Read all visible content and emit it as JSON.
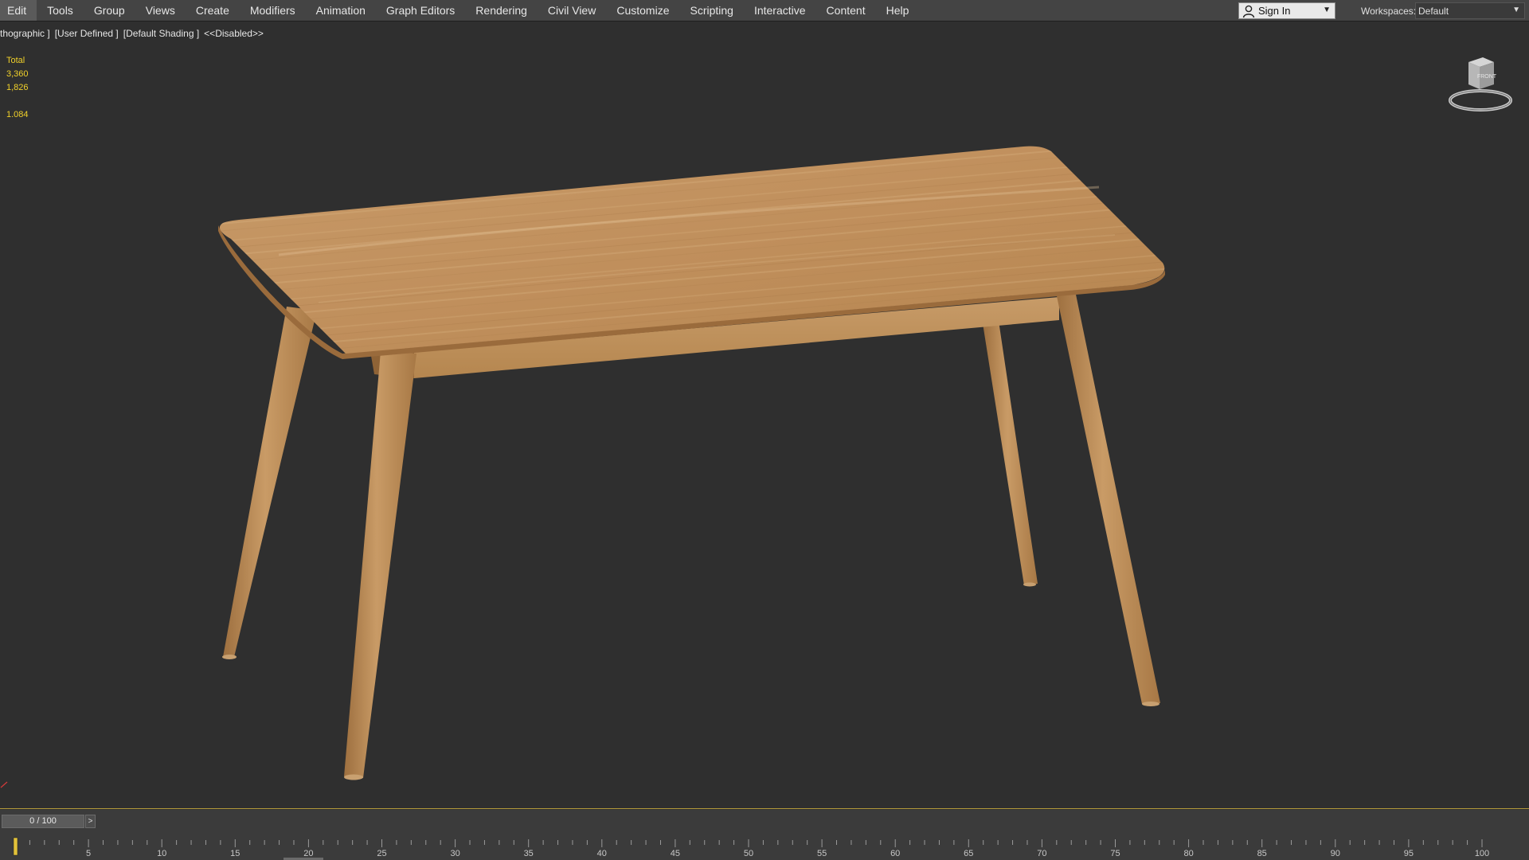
{
  "menu": {
    "items": [
      "Edit",
      "Tools",
      "Group",
      "Views",
      "Create",
      "Modifiers",
      "Animation",
      "Graph Editors",
      "Rendering",
      "Civil View",
      "Customize",
      "Scripting",
      "Interactive",
      "Content",
      "Help"
    ]
  },
  "account": {
    "sign_in_label": "Sign In"
  },
  "workspaces": {
    "label": "Workspaces:",
    "value": "Default"
  },
  "viewport": {
    "label_projection": "[ +] [Orthographic ]",
    "label_view_shown": "thographic ]",
    "label_user": "[User Defined ]",
    "label_shading": "[Default Shading ]",
    "label_disabled": "<<Disabled>>",
    "stats": {
      "title": "Total",
      "polys": "3,360",
      "verts": "1,826",
      "fps": "1.084"
    },
    "viewcube_face": "FRONT"
  },
  "timeline": {
    "slider_text": "0 / 100",
    "next_label": ">",
    "current_frame": 0,
    "start": 0,
    "end": 100,
    "tick_labels": [
      "5",
      "10",
      "15",
      "20",
      "25",
      "30",
      "35",
      "40",
      "45",
      "50",
      "55",
      "60",
      "65",
      "70",
      "75",
      "80",
      "85",
      "90",
      "95",
      "100"
    ]
  },
  "colors": {
    "background": "#2f2f2f",
    "menubar": "#444444",
    "stats_text": "#f0d02a",
    "wood_light": "#c89a66",
    "wood_dark": "#a3743f",
    "accent_border": "#b59a3a"
  },
  "icons": {
    "user": "user-icon",
    "dropdown": "chevron-down-icon",
    "viewcube": "viewcube-icon",
    "axis": "axis-tripod-icon"
  }
}
